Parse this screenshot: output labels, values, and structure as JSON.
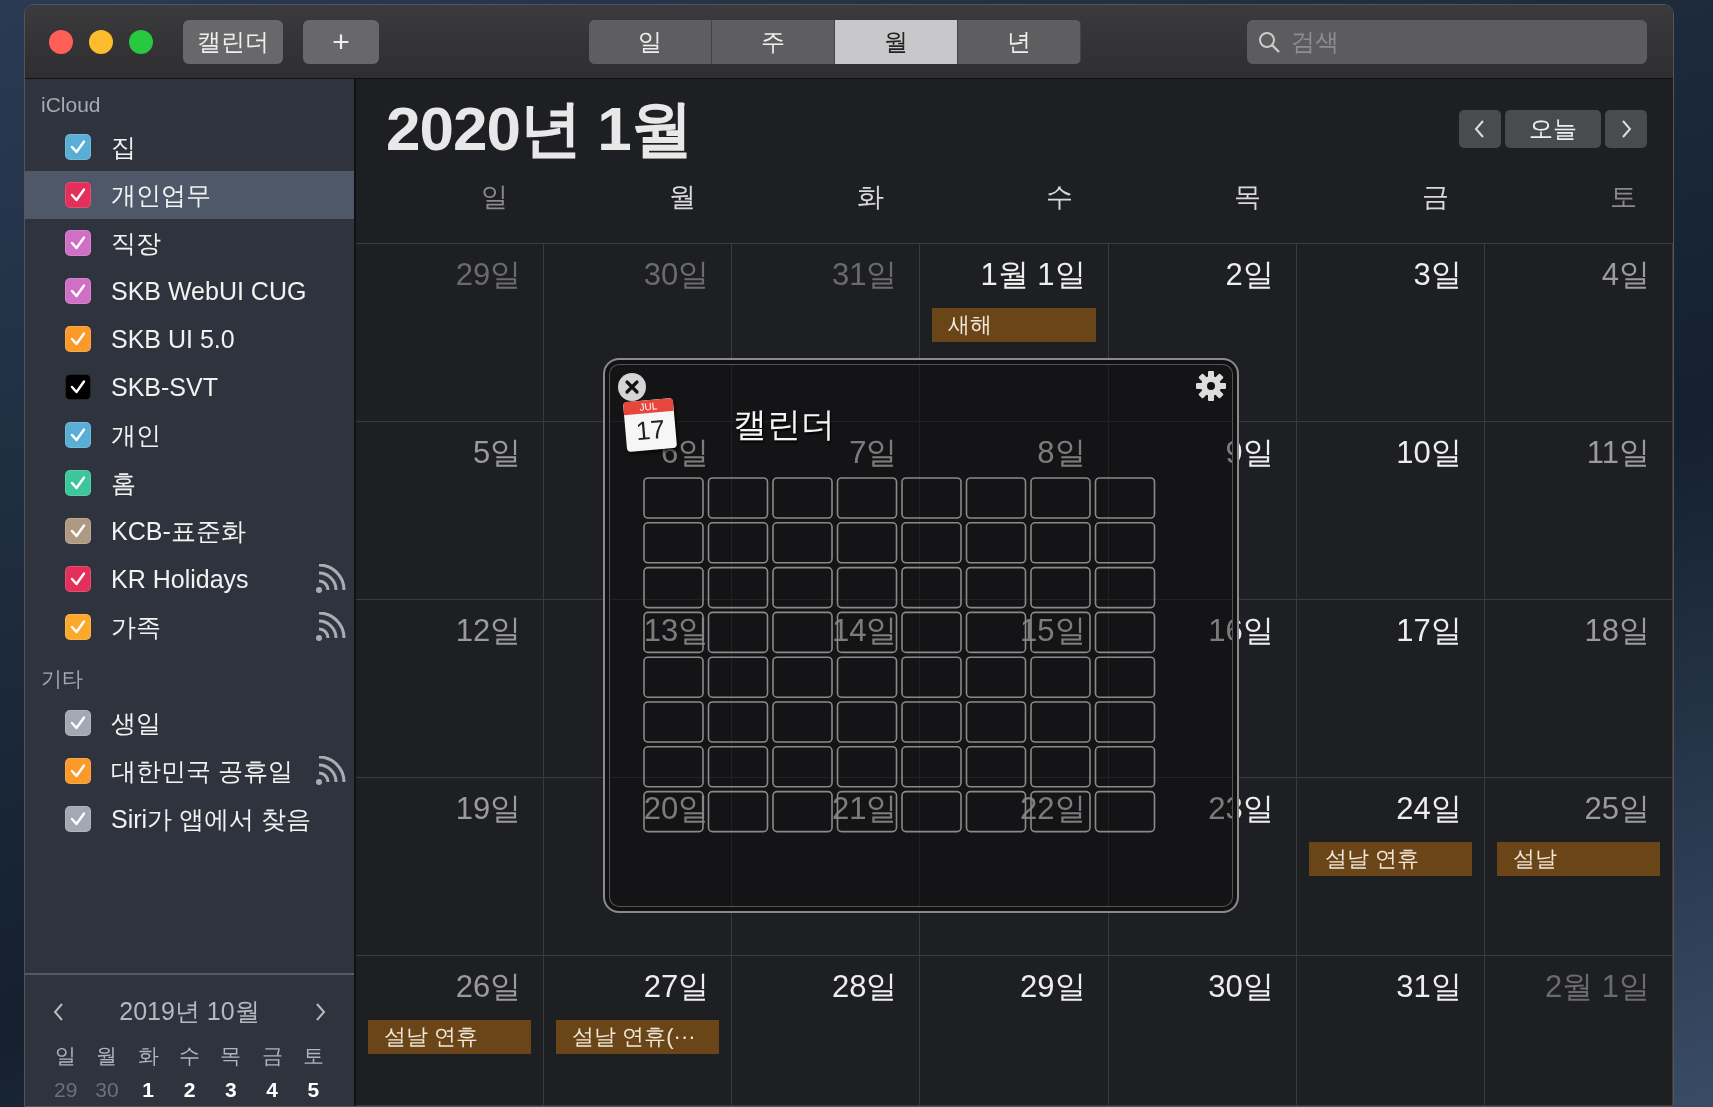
{
  "toolbar": {
    "calendars_button": "캘린더",
    "add_button": "+",
    "view_tabs": [
      {
        "label": "일",
        "selected": false
      },
      {
        "label": "주",
        "selected": false
      },
      {
        "label": "월",
        "selected": true
      },
      {
        "label": "년",
        "selected": false
      }
    ],
    "search": {
      "placeholder": "검색"
    }
  },
  "sidebar": {
    "sections": [
      {
        "title": "iCloud",
        "items": [
          {
            "label": "집",
            "color": "#5aaed6",
            "checked": true,
            "selected": false,
            "subscribed": false
          },
          {
            "label": "개인업무",
            "color": "#e2305a",
            "checked": true,
            "selected": true,
            "subscribed": false
          },
          {
            "label": "직장",
            "color": "#cf6fc6",
            "checked": true,
            "selected": false,
            "subscribed": false
          },
          {
            "label": "SKB WebUI CUG",
            "color": "#cf6fc6",
            "checked": true,
            "selected": false,
            "subscribed": false
          },
          {
            "label": "SKB UI 5.0",
            "color": "#fa9a28",
            "checked": true,
            "selected": false,
            "subscribed": false
          },
          {
            "label": "SKB-SVT",
            "color": "#000000",
            "checked": true,
            "selected": false,
            "subscribed": false
          },
          {
            "label": "개인",
            "color": "#5aaed6",
            "checked": true,
            "selected": false,
            "subscribed": false
          },
          {
            "label": "홈",
            "color": "#3fc59c",
            "checked": true,
            "selected": false,
            "subscribed": false
          },
          {
            "label": "KCB-표준화",
            "color": "#ae9a82",
            "checked": true,
            "selected": false,
            "subscribed": false
          },
          {
            "label": "KR Holidays",
            "color": "#e2305a",
            "checked": true,
            "selected": false,
            "subscribed": true
          },
          {
            "label": "가족",
            "color": "#fba92c",
            "checked": true,
            "selected": false,
            "subscribed": true
          }
        ]
      },
      {
        "title": "기타",
        "items": [
          {
            "label": "생일",
            "color": "#a2a9b2",
            "checked": true,
            "selected": false,
            "subscribed": false
          },
          {
            "label": "대한민국 공휴일",
            "color": "#fa9a28",
            "checked": true,
            "selected": false,
            "subscribed": true
          },
          {
            "label": "Siri가 앱에서 찾음",
            "color": "#a2a9b2",
            "checked": true,
            "selected": false,
            "subscribed": false
          }
        ]
      }
    ],
    "mini_calendar": {
      "title": "2019년 10월",
      "weekdays": [
        "일",
        "월",
        "화",
        "수",
        "목",
        "금",
        "토"
      ],
      "days": [
        {
          "label": "29",
          "other_month": true
        },
        {
          "label": "30",
          "other_month": true
        },
        {
          "label": "1",
          "other_month": false
        },
        {
          "label": "2",
          "other_month": false
        },
        {
          "label": "3",
          "other_month": false
        },
        {
          "label": "4",
          "other_month": false
        },
        {
          "label": "5",
          "other_month": false
        }
      ]
    }
  },
  "main": {
    "title": "2020년 1월",
    "today_button": "오늘",
    "weekdays": [
      {
        "label": "일",
        "weekend": true
      },
      {
        "label": "월",
        "weekend": false
      },
      {
        "label": "화",
        "weekend": false
      },
      {
        "label": "수",
        "weekend": false
      },
      {
        "label": "목",
        "weekend": false
      },
      {
        "label": "금",
        "weekend": false
      },
      {
        "label": "토",
        "weekend": true
      }
    ],
    "weeks": [
      [
        {
          "label": "29일",
          "kind": "other"
        },
        {
          "label": "30일",
          "kind": "other"
        },
        {
          "label": "31일",
          "kind": "other"
        },
        {
          "label": "1월 1일",
          "kind": "weekday",
          "events": [
            "새해"
          ]
        },
        {
          "label": "2일",
          "kind": "weekday"
        },
        {
          "label": "3일",
          "kind": "weekday"
        },
        {
          "label": "4일",
          "kind": "weekend"
        }
      ],
      [
        {
          "label": "5일",
          "kind": "weekend"
        },
        {
          "label": "6일",
          "kind": "weekday"
        },
        {
          "label": "7일",
          "kind": "weekday"
        },
        {
          "label": "8일",
          "kind": "weekday"
        },
        {
          "label": "9일",
          "kind": "weekday"
        },
        {
          "label": "10일",
          "kind": "weekday"
        },
        {
          "label": "11일",
          "kind": "weekend"
        }
      ],
      [
        {
          "label": "12일",
          "kind": "weekend"
        },
        {
          "label": "13일",
          "kind": "weekday"
        },
        {
          "label": "14일",
          "kind": "weekday"
        },
        {
          "label": "15일",
          "kind": "weekday"
        },
        {
          "label": "16일",
          "kind": "weekday"
        },
        {
          "label": "17일",
          "kind": "weekday"
        },
        {
          "label": "18일",
          "kind": "weekend"
        }
      ],
      [
        {
          "label": "19일",
          "kind": "weekend"
        },
        {
          "label": "20일",
          "kind": "weekday"
        },
        {
          "label": "21일",
          "kind": "weekday"
        },
        {
          "label": "22일",
          "kind": "weekday"
        },
        {
          "label": "23일",
          "kind": "weekday"
        },
        {
          "label": "24일",
          "kind": "weekday",
          "events": [
            "설날 연휴"
          ]
        },
        {
          "label": "25일",
          "kind": "weekend",
          "events": [
            "설날"
          ]
        }
      ],
      [
        {
          "label": "26일",
          "kind": "weekend",
          "events": [
            "설날 연휴"
          ]
        },
        {
          "label": "27일",
          "kind": "weekday",
          "events": [
            "설날 연휴(···"
          ]
        },
        {
          "label": "28일",
          "kind": "weekday"
        },
        {
          "label": "29일",
          "kind": "weekday"
        },
        {
          "label": "30일",
          "kind": "weekday"
        },
        {
          "label": "31일",
          "kind": "weekday"
        },
        {
          "label": "2월 1일",
          "kind": "other"
        }
      ]
    ]
  },
  "popup": {
    "title": "캘린더",
    "app_icon": {
      "month": "JUL",
      "day": "17"
    }
  }
}
